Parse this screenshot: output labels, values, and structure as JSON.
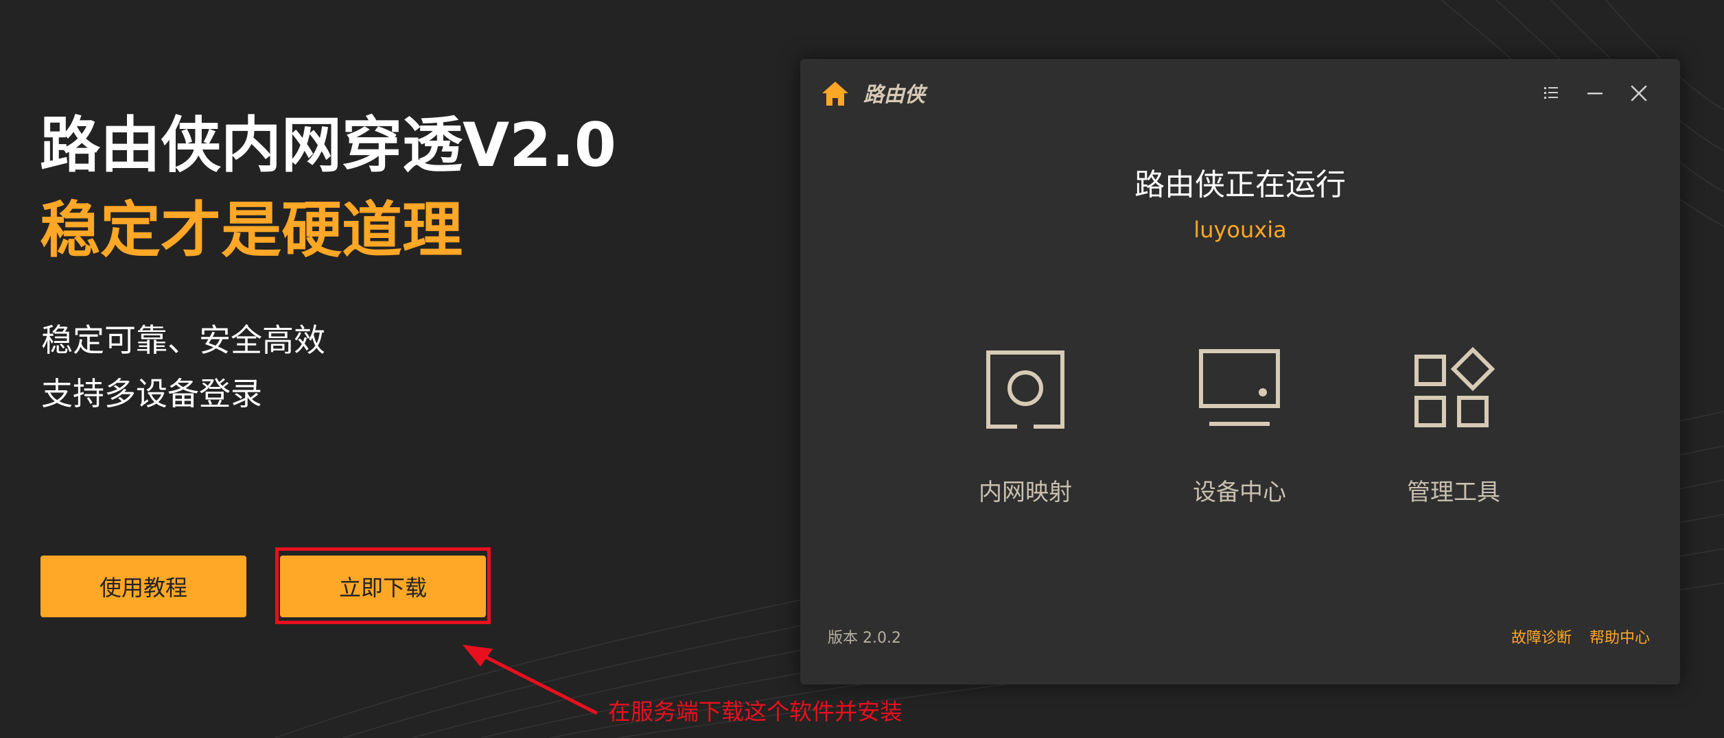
{
  "hero": {
    "title": "路由侠内网穿透V2.0",
    "subtitle": "稳定才是硬道理",
    "desc_line1": "稳定可靠、安全高效",
    "desc_line2": "支持多设备登录"
  },
  "buttons": {
    "tutorial_label": "使用教程",
    "download_label": "立即下载"
  },
  "annotation": {
    "text": "在服务端下载这个软件并安装"
  },
  "app": {
    "name": "路由侠",
    "logo_icon": "home-icon",
    "status_title": "路由侠正在运行",
    "username": "luyouxia",
    "features": [
      {
        "label": "内网映射",
        "icon": "port-mapping-icon"
      },
      {
        "label": "设备中心",
        "icon": "monitor-icon"
      },
      {
        "label": "管理工具",
        "icon": "tools-grid-icon"
      }
    ],
    "version": "版本 2.0.2",
    "links": {
      "diagnose": "故障诊断",
      "help": "帮助中心"
    },
    "window_controls": [
      "menu-icon",
      "minimize-icon",
      "close-icon"
    ]
  },
  "colors": {
    "background": "#232323",
    "accent": "#ffa726",
    "window": "#2f2f2f",
    "icon_tan": "#d7cbb6",
    "annotation_red": "#e8101e"
  }
}
